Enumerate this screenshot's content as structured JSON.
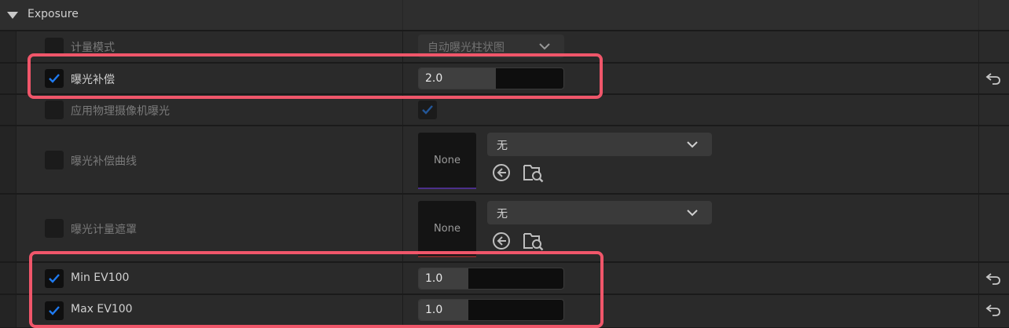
{
  "section": {
    "title": "Exposure"
  },
  "rows": {
    "metering_mode": {
      "label": "计量模式",
      "checked": false,
      "value": "自动曝光柱状图"
    },
    "exposure_compensation": {
      "label": "曝光补偿",
      "checked": true,
      "value": "2.0",
      "slider_fraction": 0.53
    },
    "apply_physical_camera_exposure": {
      "label": "应用物理摄像机曝光",
      "checked": false,
      "value_checked": true
    },
    "exposure_compensation_curve": {
      "label": "曝光补偿曲线",
      "checked": false,
      "asset_value": "无",
      "thumbnail": "None"
    },
    "exposure_metering_mask": {
      "label": "曝光计量遮罩",
      "checked": false,
      "asset_value": "无",
      "thumbnail": "None"
    },
    "min_ev100": {
      "label": "Min EV100",
      "checked": true,
      "value": "1.0",
      "slider_fraction": 0.34
    },
    "max_ev100": {
      "label": "Max EV100",
      "checked": true,
      "value": "1.0",
      "slider_fraction": 0.34
    }
  },
  "icons": {
    "collapse": "triangle-down-icon",
    "checkmark": "checkmark-icon",
    "dropdown": "chevron-down-icon",
    "use_selected": "arrow-left-circle-icon",
    "browse": "folder-search-icon",
    "reset": "reset-arrow-icon"
  },
  "colors": {
    "highlight": "#f0566a",
    "check_accent": "#1f7bf2",
    "curve_thumb_bar": "#4b2f8a",
    "mask_thumb_bar": "#7a2a2a"
  }
}
